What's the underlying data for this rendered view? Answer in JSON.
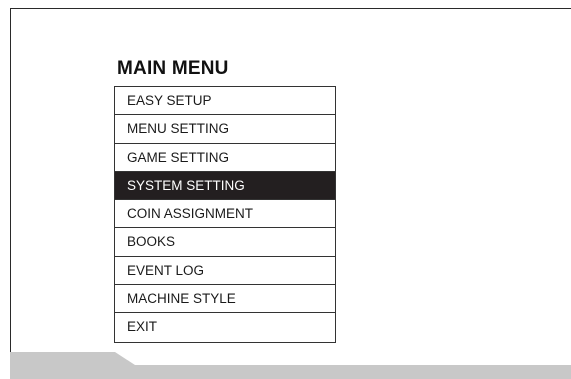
{
  "menu": {
    "title": "MAIN MENU",
    "items": [
      {
        "label": "EASY SETUP",
        "selected": false
      },
      {
        "label": "MENU SETTING",
        "selected": false
      },
      {
        "label": "GAME SETTING",
        "selected": false
      },
      {
        "label": "SYSTEM SETTING",
        "selected": true
      },
      {
        "label": "COIN ASSIGNMENT",
        "selected": false
      },
      {
        "label": "BOOKS",
        "selected": false
      },
      {
        "label": "EVENT LOG",
        "selected": false
      },
      {
        "label": "MACHINE STYLE",
        "selected": false
      },
      {
        "label": "EXIT",
        "selected": false
      }
    ]
  },
  "colors": {
    "selected_background": "#231f20",
    "selected_text": "#ffffff",
    "bottom_bar": "#c8c8c8"
  }
}
